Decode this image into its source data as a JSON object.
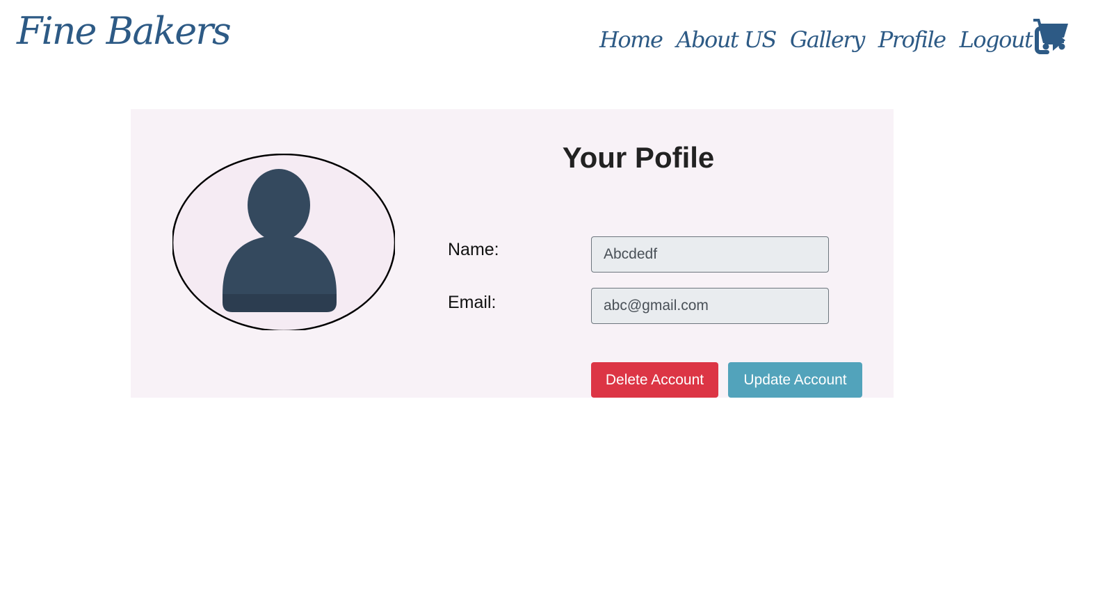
{
  "navbar": {
    "brand": "Fine Bakers",
    "links": [
      "Home",
      "About US",
      "Gallery",
      "Profile",
      "Logout"
    ],
    "icons": {
      "logout": "sign-out-icon",
      "cart": "shopping-cart-icon"
    }
  },
  "profile": {
    "title": "Your Pofile",
    "avatar_icon": "user-avatar-icon",
    "name_label": "Name:",
    "name_value": "Abcdedf",
    "email_label": "Email:",
    "email_value": "abc@gmail.com",
    "delete_label": "Delete Account",
    "update_label": "Update Account"
  },
  "colors": {
    "brand": "#2d5a85",
    "card_background": "#f8f2f7",
    "delete_button": "#dc3545",
    "update_button": "#52a3bb",
    "input_background": "#e9ecef",
    "avatar_figure": "#34495e"
  }
}
